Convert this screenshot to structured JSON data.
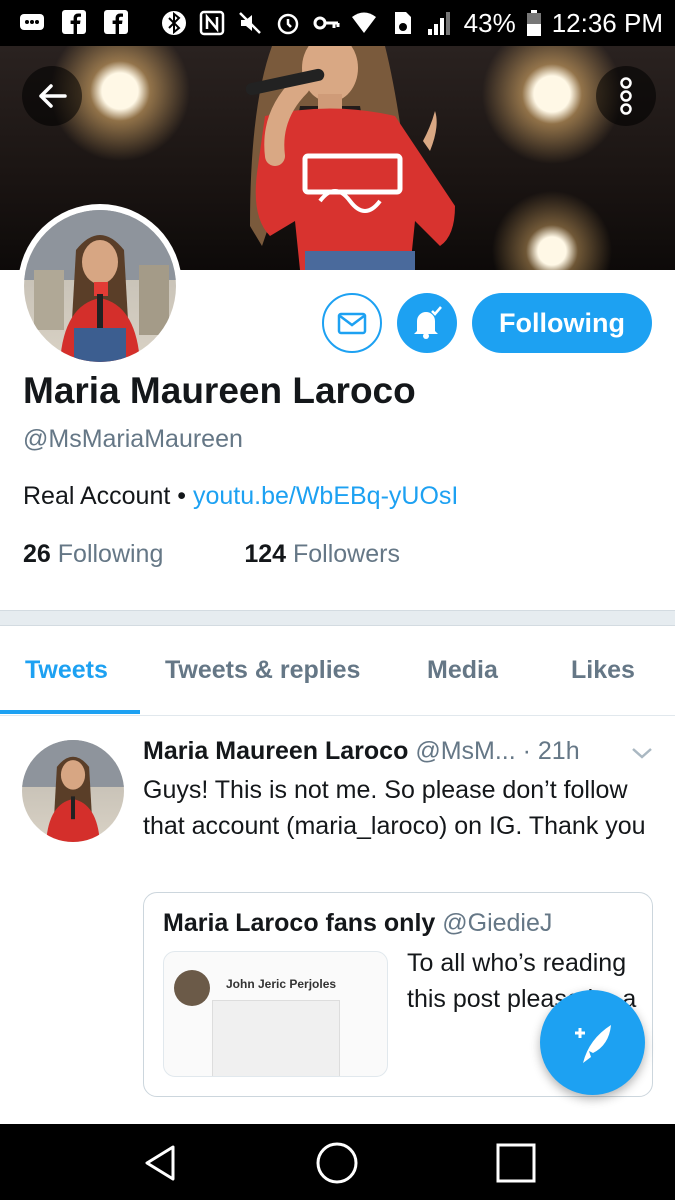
{
  "status_bar": {
    "battery": "43%",
    "time": "12:36 PM",
    "icons": [
      "messenger-icon",
      "facebook-icon",
      "facebook-icon",
      "bluetooth-icon",
      "nfc-icon",
      "mute-icon",
      "alarm-icon",
      "vpn-key-icon",
      "wifi-icon",
      "sd-card-icon",
      "signal-icon",
      "battery-icon"
    ]
  },
  "header": {
    "back_icon": "arrow-left-icon",
    "more_icon": "more-vertical-icon"
  },
  "profile": {
    "name": "Maria Maureen Laroco",
    "handle": "@MsMariaMaureen",
    "bio_text": "Real Account • ",
    "bio_link": "youtu.be/WbEBq-yUOsI",
    "following_count": "26",
    "following_label": "Following",
    "followers_count": "124",
    "followers_label": "Followers",
    "follow_button": "Following",
    "colors": {
      "accent": "#1da1f2",
      "muted": "#657786",
      "text": "#14171a"
    }
  },
  "tabs": [
    {
      "label": "Tweets",
      "active": true
    },
    {
      "label": "Tweets & replies",
      "active": false
    },
    {
      "label": "Media",
      "active": false
    },
    {
      "label": "Likes",
      "active": false
    }
  ],
  "tweet": {
    "name": "Maria Maureen Laroco",
    "meta": "@MsM... · 21h",
    "text": "Guys! This is not me. So please don’t follow that account (maria_laroco) on IG. Thank you",
    "quote": {
      "name": "Maria Laroco fans only",
      "handle": "@GiedieJ",
      "text": "To all who’s reading this post please be a",
      "card_name": "John Jeric Perjoles"
    }
  },
  "fab": {
    "icon": "compose-tweet-icon"
  },
  "nav_bar": {
    "icons": [
      "back-triangle-icon",
      "home-circle-icon",
      "recents-square-icon"
    ]
  }
}
